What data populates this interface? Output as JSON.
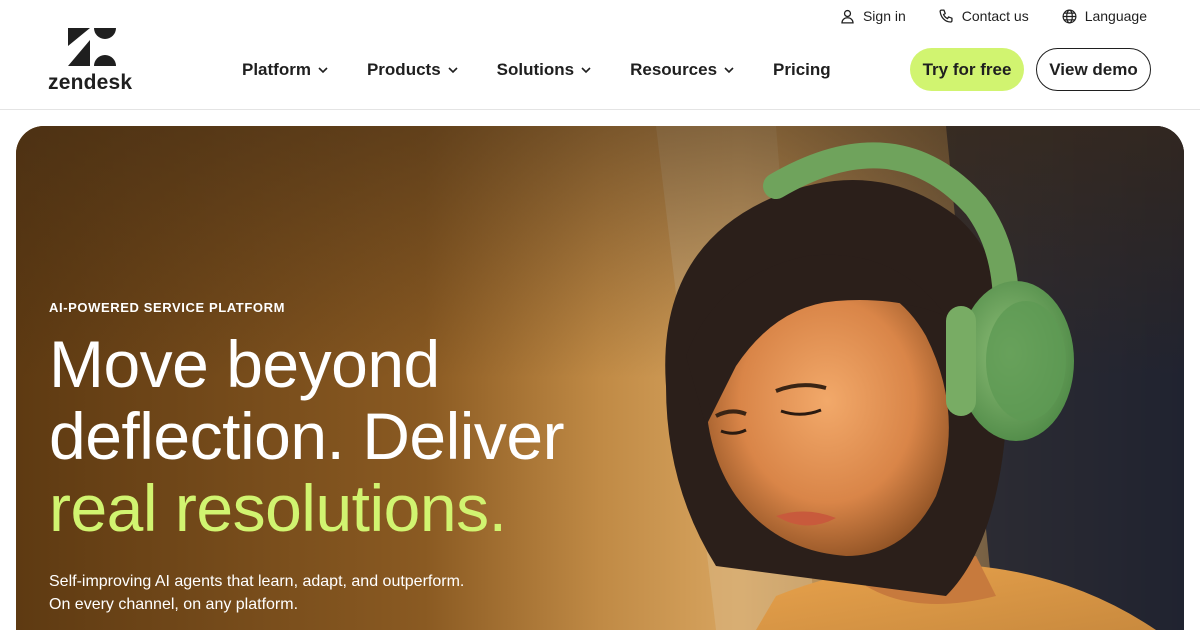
{
  "utility": {
    "sign_in": "Sign in",
    "contact_us": "Contact us",
    "language": "Language"
  },
  "logo": {
    "wordmark": "zendesk",
    "icon": "zendesk-logo-mark"
  },
  "nav": {
    "items": [
      {
        "label": "Platform",
        "has_dropdown": true
      },
      {
        "label": "Products",
        "has_dropdown": true
      },
      {
        "label": "Solutions",
        "has_dropdown": true
      },
      {
        "label": "Resources",
        "has_dropdown": true
      },
      {
        "label": "Pricing",
        "has_dropdown": false
      }
    ]
  },
  "cta": {
    "try_free": "Try for free",
    "view_demo": "View demo"
  },
  "hero": {
    "eyebrow": "AI-POWERED SERVICE PLATFORM",
    "headline_line1": "Move beyond",
    "headline_line2": "deflection. Deliver",
    "headline_accent": "real resolutions.",
    "subhead_line1": "Self-improving AI agents that learn, adapt, and outperform.",
    "subhead_line2": "On every channel, on any platform."
  },
  "colors": {
    "accent_lime": "#d1f470",
    "text_dark": "#1f1f1f",
    "hero_bg": "#6b4317"
  }
}
